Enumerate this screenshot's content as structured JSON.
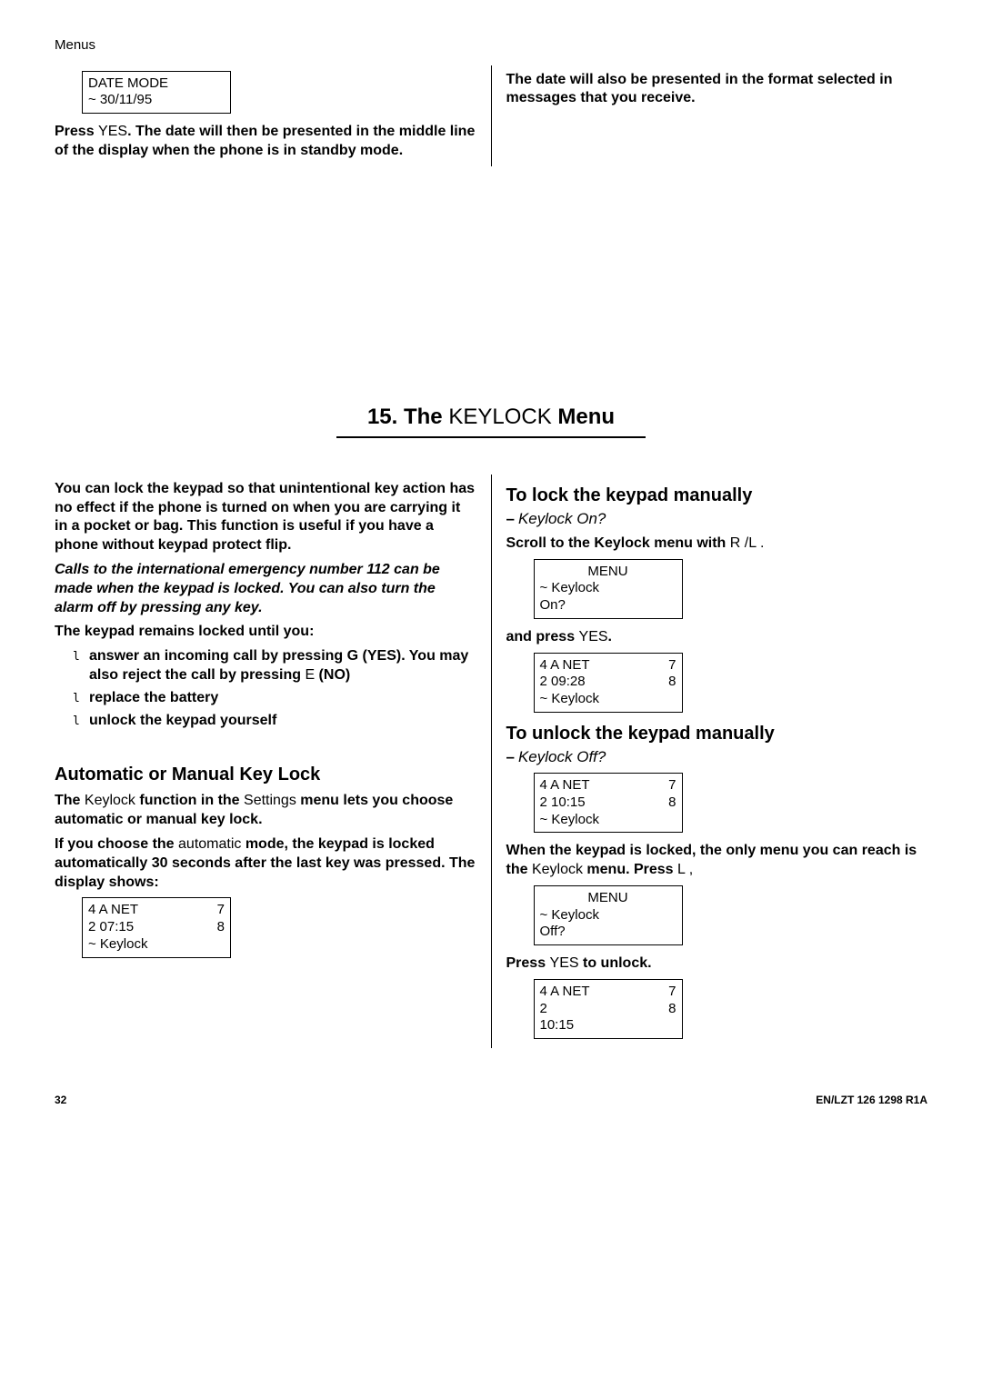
{
  "header": {
    "run": "Menus"
  },
  "top": {
    "box1": {
      "l1": "DATE MODE",
      "l2": "~ 30/11/95"
    },
    "left_p": {
      "t1": "Press ",
      "t2": "YES",
      "t3": ". The date will then be presented in the middle line of the display when the phone is in standby mode."
    },
    "right_p": "The date will also be presented in the format selected in messages that you receive."
  },
  "section": {
    "num": "15.",
    "pre": "The ",
    "word": "KEYLOCK",
    "post": " Menu"
  },
  "left": {
    "p1": "You can lock the keypad so that unintentional key action has no effect if the phone is turned on when you are carrying it in a pocket or bag. This function is useful if you have a phone without keypad protect flip.",
    "p2": "Calls to the international emergency number 112 can be made when the keypad is locked. You can also turn the alarm off by pressing any key.",
    "p3": "The keypad remains locked until you:",
    "li1a": "answer an incoming call by pressing ",
    "li1b": "G (YES). You may also reject the call by pressing ",
    "li1c": "E",
    "li1d": " (NO)",
    "li2": "replace the battery",
    "li3": "unlock the keypad yourself",
    "h3": "Automatic or Manual Key Lock",
    "p4a": "The ",
    "p4b": "Keylock ",
    "p4c": "function in the ",
    "p4d": "Settings ",
    "p4e": "menu lets you choose automatic or manual key lock.",
    "p5a": "If you choose the ",
    "p5b": "automatic ",
    "p5c": "mode, the keypad is locked automatically 30 seconds after the last key was pressed. The display shows:",
    "box2": {
      "r1l": "4   A NET",
      "r1r": "7",
      "r2l": "2   07:15",
      "r2r": "8",
      "r3": "~ Keylock"
    }
  },
  "right": {
    "h3a": "To lock the keypad manually",
    "suba": "Keylock On?",
    "p1a": "Scroll to the Keylock menu with ",
    "p1b": "R /L .",
    "box3": {
      "l1": "MENU",
      "l2": "~ Keylock",
      "l3": "   On?"
    },
    "p2a": "and press ",
    "p2b": "YES",
    "p2c": ".",
    "box4": {
      "r1l": "4   A NET",
      "r1r": "7",
      "r2l": "2   09:28",
      "r2r": "8",
      "r3": "~ Keylock"
    },
    "h3b": "To unlock the keypad manually",
    "subb": "Keylock Off?",
    "box5": {
      "r1l": "4   A NET",
      "r1r": "7",
      "r2l": "2   10:15",
      "r2r": "8",
      "r3": "~ Keylock"
    },
    "p3a": "When the keypad is locked, the only menu you can reach is the ",
    "p3b": "Keylock ",
    "p3c": "menu. Press ",
    "p3d": "L ,",
    "box6": {
      "l1": "MENU",
      "l2": "~ Keylock",
      "l3": "   Off?"
    },
    "p4a": "Press ",
    "p4b": "YES",
    "p4c": " to unlock.",
    "box7": {
      "r1l": "4   A NET",
      "r1r": "7",
      "r2l": "2",
      "r2r": "8",
      "r3": "   10:15"
    }
  },
  "footer": {
    "page": "32",
    "doc": "EN/LZT 126 1298  R1A"
  }
}
